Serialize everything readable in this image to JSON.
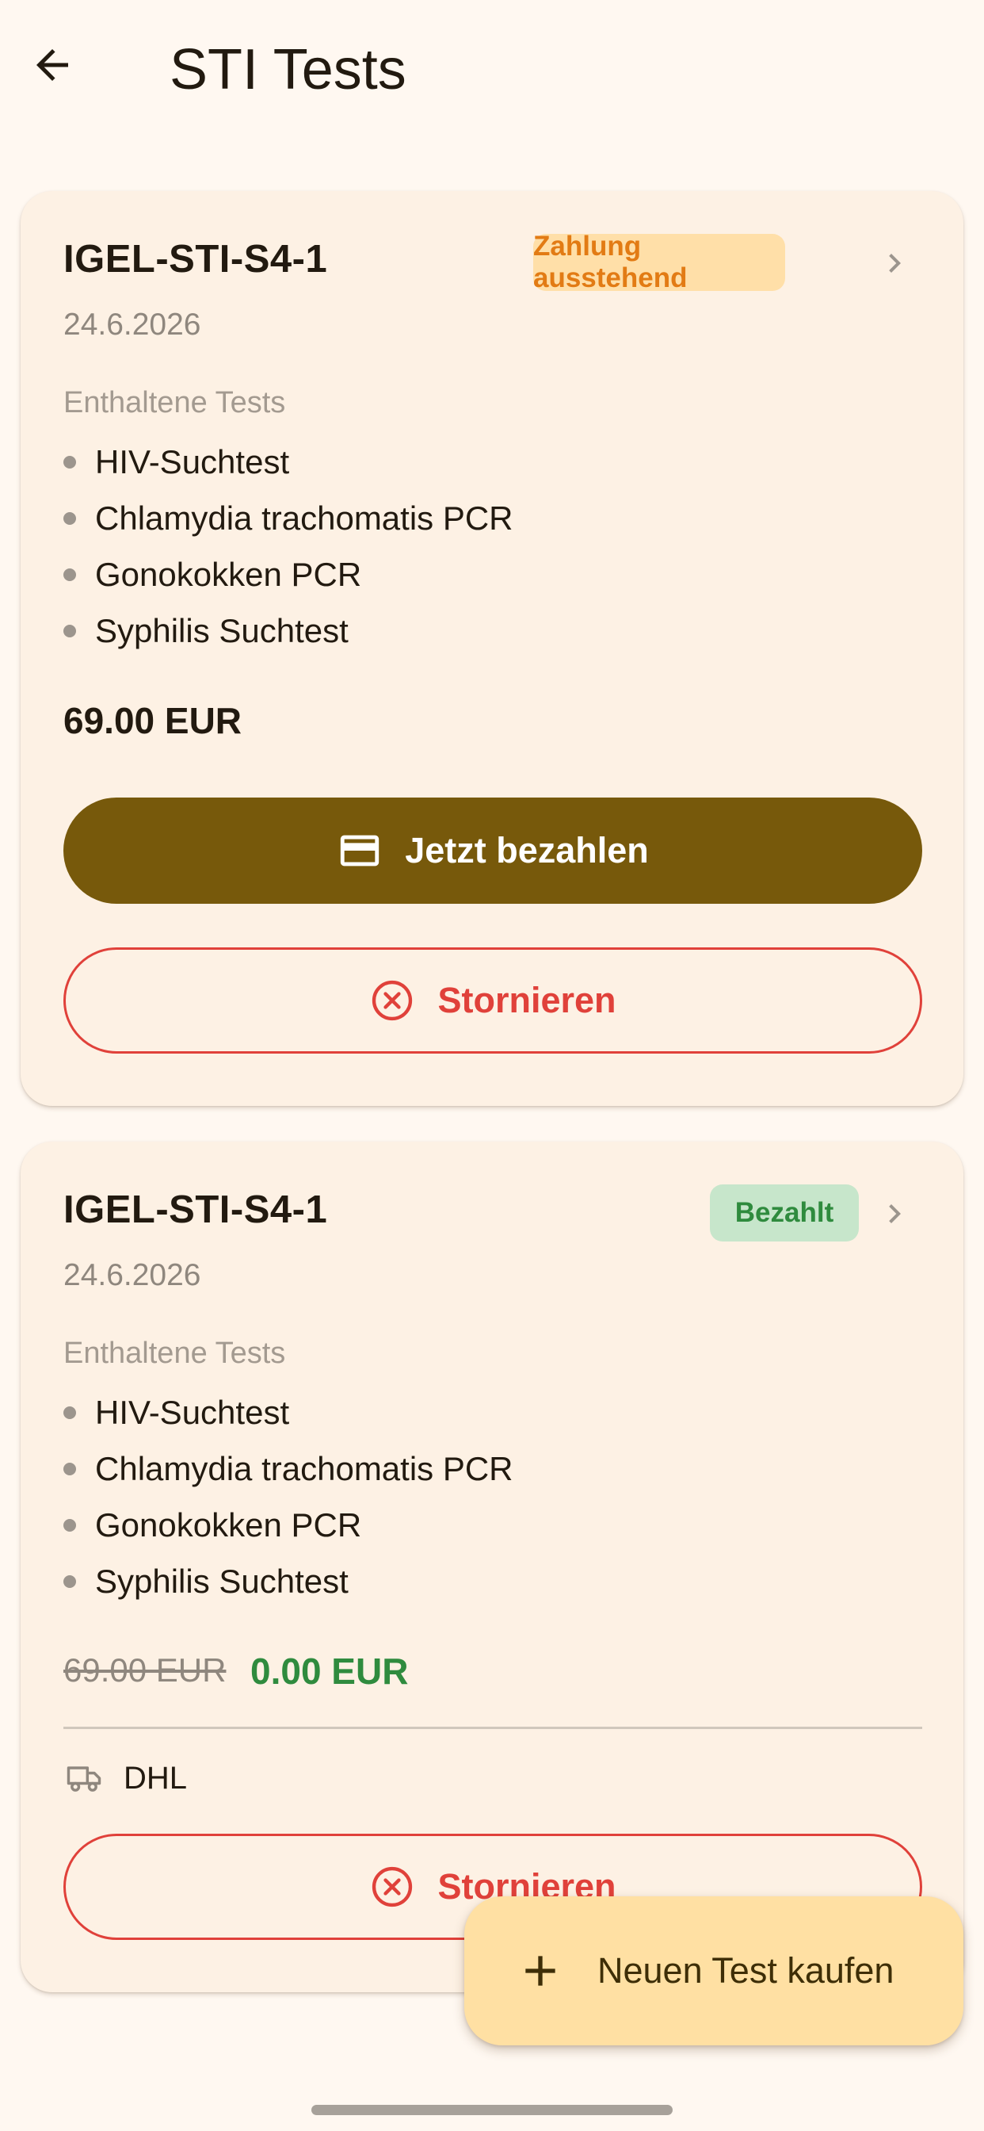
{
  "header": {
    "title": "STI Tests",
    "back_icon": "arrow-left-icon"
  },
  "tests_label": "Enthaltene Tests",
  "orders": [
    {
      "code": "IGEL-STI-S4-1",
      "date": "24.6.2026",
      "status": "Zahlung ausstehend",
      "tests": [
        "HIV-Suchtest",
        "Chlamydia trachomatis PCR",
        "Gonokokken PCR",
        "Syphilis Suchtest"
      ],
      "price": "69.00 EUR",
      "pay_label": "Jetzt bezahlen",
      "cancel_label": "Stornieren"
    },
    {
      "code": "IGEL-STI-S4-1",
      "date": "24.6.2026",
      "status": "Bezahlt",
      "tests": [
        "HIV-Suchtest",
        "Chlamydia trachomatis PCR",
        "Gonokokken PCR",
        "Syphilis Suchtest"
      ],
      "old_price": "69.00 EUR",
      "price": "0.00 EUR",
      "shipping": "DHL",
      "cancel_label": "Stornieren"
    }
  ],
  "fab": {
    "label": "Neuen Test kaufen",
    "icon": "plus-icon"
  },
  "colors": {
    "background": "#fff8f1",
    "card": "#fdf1e4",
    "primary": "#77590b",
    "danger": "#e0413a",
    "pending_bg": "#ffdfa8",
    "pending_text": "#e27b14",
    "paid_bg": "#c7e6cb",
    "paid_text": "#2f8b3e",
    "fab_bg": "#ffe0a3"
  }
}
